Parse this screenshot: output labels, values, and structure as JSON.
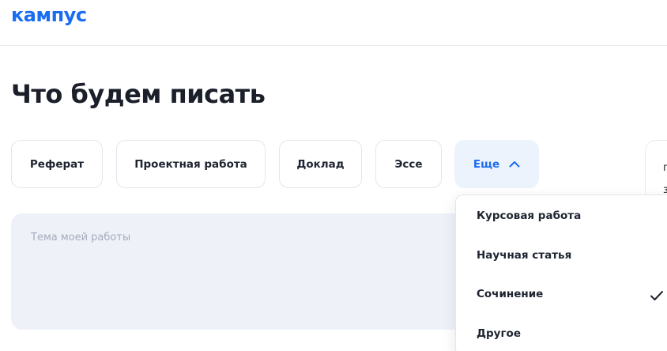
{
  "header": {
    "logo_text": "кампус"
  },
  "main": {
    "title": "Что будем писать",
    "types": [
      {
        "label": "Реферат"
      },
      {
        "label": "Проектная работа"
      },
      {
        "label": "Доклад"
      },
      {
        "label": "Эссе"
      }
    ],
    "more": {
      "label": "Еще",
      "icon": "chevron-up-icon",
      "expanded": true
    },
    "topic": {
      "placeholder": "Тема моей работы"
    },
    "dropdown": {
      "items": [
        {
          "label": "Курсовая работа",
          "selected": false
        },
        {
          "label": "Научная статья",
          "selected": false
        },
        {
          "label": "Сочинение",
          "selected": true
        },
        {
          "label": "Другое",
          "selected": false
        }
      ],
      "selected_icon": "check-icon"
    },
    "side_card": {
      "line1": "п",
      "line2": "з"
    }
  },
  "colors": {
    "accent": "#1a6cf0",
    "text": "#1b1f2a",
    "chip_border": "#e3e6ec",
    "more_bg": "#edf3fd",
    "topic_bg": "#eef2f8",
    "placeholder": "#a3abbc"
  }
}
